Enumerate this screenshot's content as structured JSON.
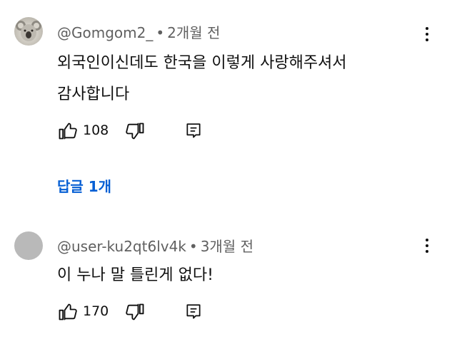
{
  "comments": [
    {
      "author": "@Gomgom2_",
      "separator": "•",
      "time": "2개월 전",
      "lines": [
        "외국인이신데도 한국을 이렇게 사랑해주셔서",
        "감사합니다"
      ],
      "likes": "108",
      "avatar": "koala-avatar"
    },
    {
      "author": "@user-ku2qt6lv4k",
      "separator": "•",
      "time": "3개월 전",
      "lines": [
        "이 누나 말 틀린게 없다!"
      ],
      "likes": "170",
      "avatar": "default-gray-avatar"
    }
  ],
  "replies_link": "답글 1개",
  "icons": {
    "like": "thumbs-up-icon",
    "dislike": "thumbs-down-icon",
    "reply": "reply-comment-icon",
    "more": "more-vertical-icon"
  },
  "colors": {
    "link": "#065fd4",
    "meta": "#606060",
    "text": "#0f0f0f"
  }
}
